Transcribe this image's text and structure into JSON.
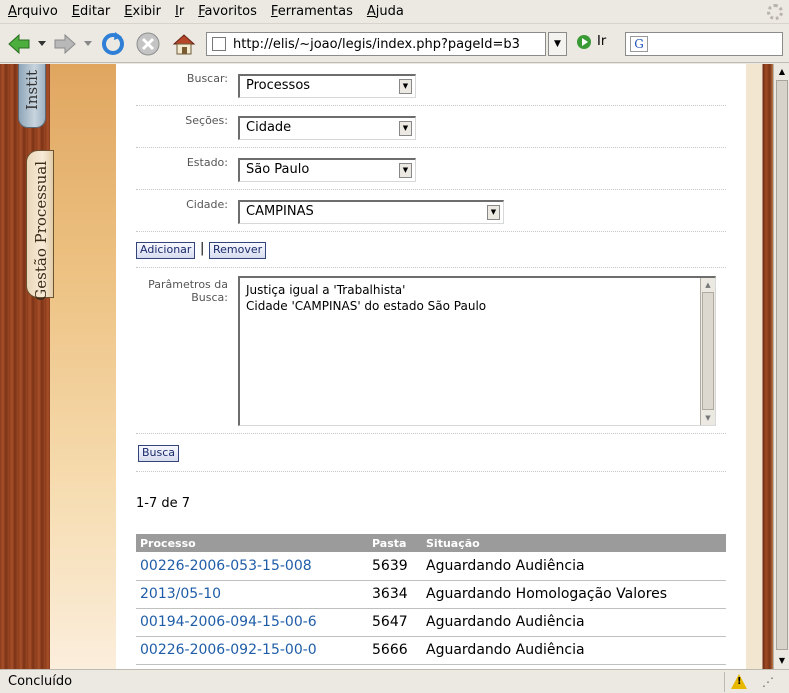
{
  "menu": [
    "Arquivo",
    "Editar",
    "Exibir",
    "Ir",
    "Favoritos",
    "Ferramentas",
    "Ajuda"
  ],
  "toolbar": {
    "url": "http://elis/~joao/legis/index.php?pageId=b3",
    "go_label": "Ir",
    "search_value": "",
    "search_engine_glyph": "G"
  },
  "side_tabs": {
    "tab_top": "Instit",
    "tab_active": "Gestão Processual"
  },
  "form": {
    "buscar_label": "Buscar:",
    "buscar_value": "Processos",
    "secoes_label": "Seções:",
    "secoes_value": "Cidade",
    "estado_label": "Estado:",
    "estado_value": "São Paulo",
    "cidade_label": "Cidade:",
    "cidade_value": "CAMPINAS",
    "add_button": "Adicionar",
    "separator": "|",
    "remove_button": "Remover",
    "params_label": "Parâmetros da Busca:",
    "params_lines": [
      "Justiça igual a 'Trabalhista'",
      "Cidade 'CAMPINAS' do estado São Paulo"
    ],
    "search_button": "Busca"
  },
  "results": {
    "count_text": "1-7 de 7",
    "columns": [
      "Processo",
      "Pasta",
      "Situação"
    ],
    "rows": [
      {
        "processo": "00226-2006-053-15-008",
        "pasta": "5639",
        "situacao": "Aguardando Audiência"
      },
      {
        "processo": "2013/05-10",
        "pasta": "3634",
        "situacao": "Aguardando Homologação Valores"
      },
      {
        "processo": "00194-2006-094-15-00-6",
        "pasta": "5647",
        "situacao": "Aguardando Audiência"
      },
      {
        "processo": "00226-2006-092-15-00-0",
        "pasta": "5666",
        "situacao": "Aguardando Audiência"
      }
    ]
  },
  "status": {
    "text": "Concluído"
  },
  "colors": {
    "link": "#1f5da8",
    "table_header": "#9b9b9b",
    "wood": "#8a3c1c",
    "parchment": "#edc283"
  }
}
